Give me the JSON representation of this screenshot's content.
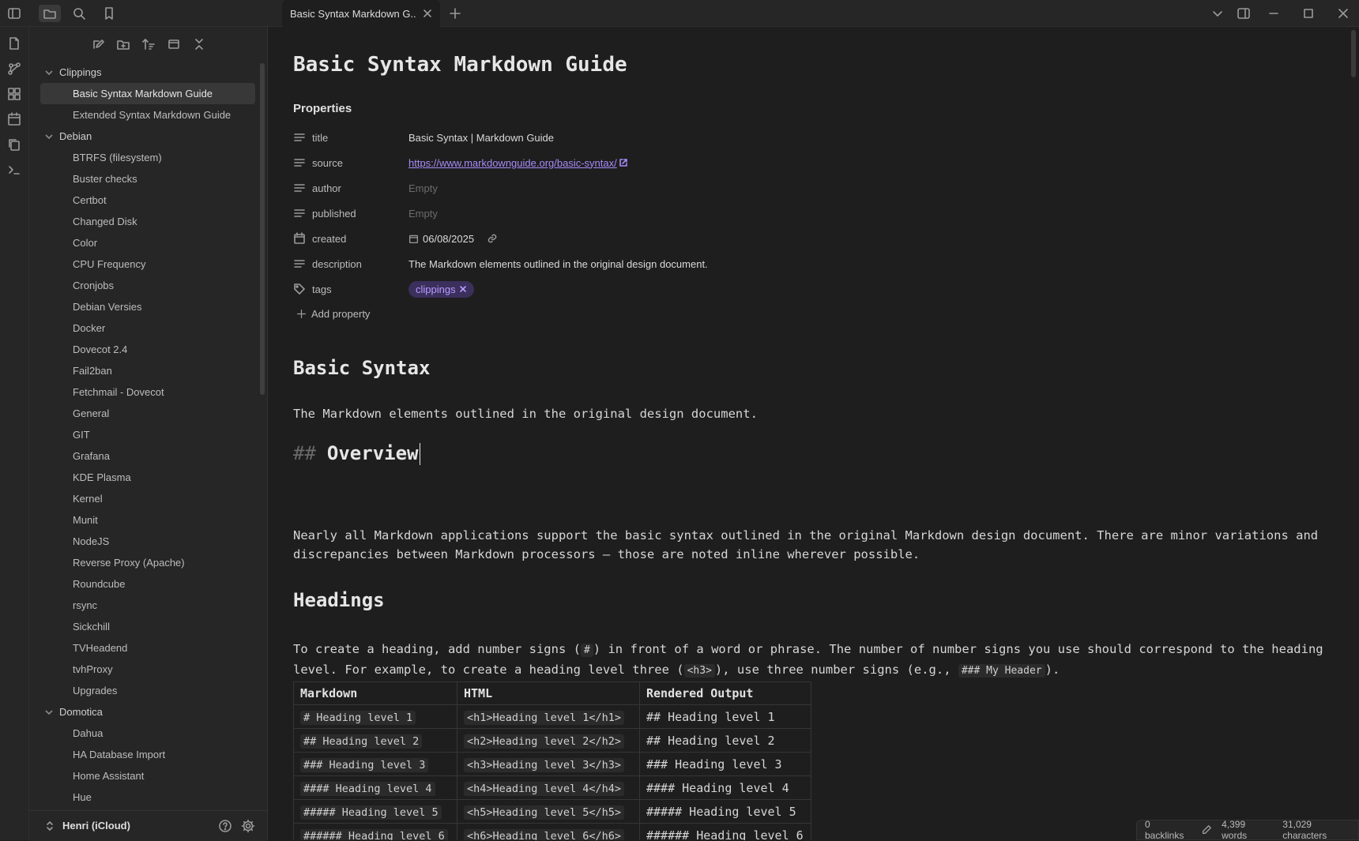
{
  "tab": {
    "title": "Basic Syntax Markdown G..."
  },
  "sidebar": {
    "groups": [
      {
        "name": "Clippings",
        "items": [
          "Basic Syntax  Markdown Guide",
          "Extended Syntax  Markdown Guide"
        ]
      },
      {
        "name": "Debian",
        "items": [
          "BTRFS (filesystem)",
          "Buster checks",
          "Certbot",
          "Changed Disk",
          "Color",
          "CPU Frequency",
          "Cronjobs",
          "Debian Versies",
          "Docker",
          "Dovecot 2.4",
          "Fail2ban",
          "Fetchmail - Dovecot",
          "General",
          "GIT",
          "Grafana",
          "KDE Plasma",
          "Kernel",
          "Munit",
          "NodeJS",
          "Reverse Proxy (Apache)",
          "Roundcube",
          "rsync",
          "Sickchill",
          "TVHeadend",
          "tvhProxy",
          "Upgrades"
        ]
      },
      {
        "name": "Domotica",
        "items": [
          "Dahua",
          "HA Database Import",
          "Home Assistant",
          "Hue"
        ]
      }
    ],
    "vault_name": "Henri (iCloud)"
  },
  "doc": {
    "title": "Basic Syntax  Markdown Guide",
    "properties_heading": "Properties",
    "properties": {
      "title": {
        "key": "title",
        "value": "Basic Syntax | Markdown Guide"
      },
      "source": {
        "key": "source",
        "value": "https://www.markdownguide.org/basic-syntax/"
      },
      "author": {
        "key": "author",
        "value": "Empty"
      },
      "published": {
        "key": "published",
        "value": "Empty"
      },
      "created": {
        "key": "created",
        "value": "06/08/2025"
      },
      "description": {
        "key": "description",
        "value": "The Markdown elements outlined in the original design document."
      },
      "tags": {
        "key": "tags",
        "value": "clippings"
      }
    },
    "add_property": "Add property",
    "h_basic": "Basic Syntax",
    "p_basic": "The Markdown elements outlined in the original design document.",
    "h_overview_hash": "##",
    "h_overview": "Overview",
    "p_overview": "Nearly all Markdown applications support the basic syntax outlined in the original Markdown design document. There are minor variations and discrepancies between Markdown processors — those are noted inline wherever possible.",
    "h_headings": "Headings",
    "p_headings": {
      "part1": "To create a heading, add number signs (",
      "code1": "#",
      "part2": ") in front of a word or phrase. The number of number signs you use should correspond to the heading level. For example, to create a heading level three (",
      "code2": "<h3>",
      "part3": "), use three number signs (e.g., ",
      "code3": "### My Header",
      "part4": ")."
    },
    "table": {
      "headers": [
        "Markdown",
        "HTML",
        "Rendered Output"
      ],
      "rows": [
        [
          "# Heading level 1",
          "<h1>Heading level 1</h1>",
          "## Heading level 1"
        ],
        [
          "## Heading level 2",
          "<h2>Heading level 2</h2>",
          "## Heading level 2"
        ],
        [
          "### Heading level 3",
          "<h3>Heading level 3</h3>",
          "### Heading level 3"
        ],
        [
          "#### Heading level 4",
          "<h4>Heading level  4</h4>",
          "#### Heading level 4"
        ],
        [
          "##### Heading level 5",
          "<h5>Heading level 5</h5>",
          "##### Heading level 5"
        ],
        [
          "###### Heading level 6",
          "<h6>Heading level 6</h6>",
          "###### Heading level 6"
        ]
      ]
    }
  },
  "status": {
    "backlinks": "0 backlinks",
    "words": "4,399 words",
    "characters": "31,029 characters"
  },
  "colors": {
    "accent": "#a88bfa",
    "tag_bg": "#3b2f5c",
    "background": "#1e1e1e",
    "sidebar": "#262626"
  }
}
